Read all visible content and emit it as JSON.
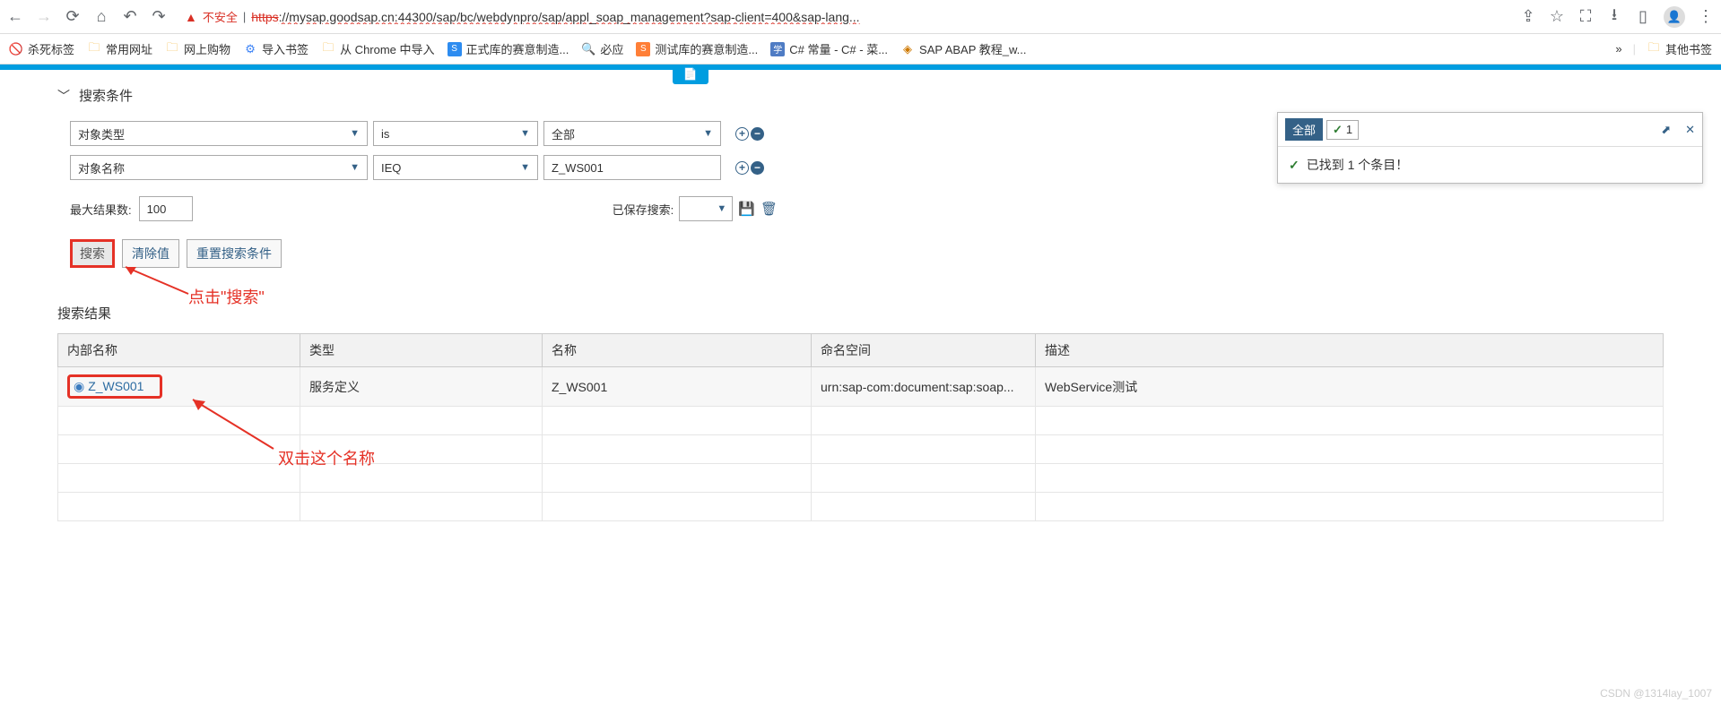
{
  "browser": {
    "insecure_label": "不安全",
    "url_proto": "https",
    "url_rest": "://mysap.goodsap.cn:44300/sap/bc/webdynpro/sap/appl_soap_management?sap-client=400&sap-lang..."
  },
  "bookmarks": {
    "kill_tabs": "杀死标签",
    "common": "常用网址",
    "shopping": "网上购物",
    "import": "导入书签",
    "from_chrome": "从 Chrome 中导入",
    "formal": "正式库的赛意制造...",
    "bing": "必应",
    "test_lib": "测试库的赛意制造...",
    "csharp": "C# 常量 - C# - 菜...",
    "sap_abap": "SAP ABAP 教程_w...",
    "more": "»",
    "other": "其他书签"
  },
  "search": {
    "section_title": "搜索条件",
    "row1": {
      "field": "对象类型",
      "op": "is",
      "val": "全部"
    },
    "row2": {
      "field": "对象名称",
      "op": "IEQ",
      "val": "Z_WS001"
    },
    "max_label": "最大结果数:",
    "max_value": "100",
    "saved_label": "已保存搜索:",
    "btn_search": "搜索",
    "btn_clear": "清除值",
    "btn_reset": "重置搜索条件"
  },
  "annotations": {
    "click_search": "点击\"搜索\"",
    "dbl_click": "双击这个名称"
  },
  "results": {
    "title": "搜索结果",
    "headers": {
      "h1": "内部名称",
      "h2": "类型",
      "h3": "名称",
      "h4": "命名空间",
      "h5": "描述"
    },
    "row": {
      "internal_name": "Z_WS001",
      "type": "服务定义",
      "name": "Z_WS001",
      "namespace": "urn:sap-com:document:sap:soap...",
      "desc": "WebService测试"
    }
  },
  "notif": {
    "all": "全部",
    "count": "1",
    "msg": "已找到 1 个条目！"
  },
  "watermark": "CSDN @1314lay_1007"
}
